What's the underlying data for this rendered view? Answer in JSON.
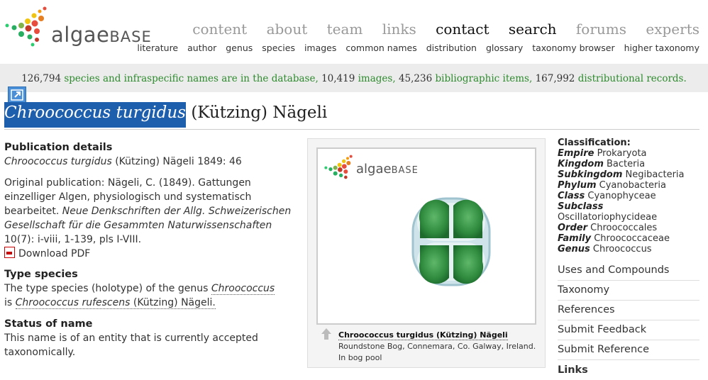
{
  "header": {
    "logo_text": "algae",
    "logo_text_b": "BASE",
    "main_nav": [
      "content",
      "about",
      "team",
      "links",
      "contact",
      "search",
      "forums",
      "experts"
    ],
    "sub_nav": [
      "literature",
      "author",
      "genus",
      "species",
      "images",
      "common names",
      "distribution",
      "glossary",
      "taxonomy browser",
      "higher taxonomy"
    ]
  },
  "stats": {
    "n_species": "126,794",
    "t_species": "species and infraspecific names are in the database,",
    "n_images": "10,419",
    "t_images": "images,",
    "n_biblio": "45,236",
    "t_biblio": "bibliographic items,",
    "n_dist": "167,992",
    "t_dist": "distributional records."
  },
  "title": {
    "name": "Chroococcus turgidus",
    "author": "(Kützing) Nägeli"
  },
  "publication": {
    "heading": "Publication details",
    "name": "Chroococcus turgidus",
    "citation": "(Kützing) Nägeli 1849: 46",
    "orig_prefix": "Original publication: Nägeli, C. (1849). Gattungen einzelliger Algen, physiologisch und systematisch bearbeitet.",
    "orig_journal": "Neue Denkschriften der Allg. Schweizerischen Gesellschaft für die Gesammten Naturwissenschaften",
    "orig_suffix": "10(7): i-viii, 1-139, pls I-VIII.",
    "pdf_label": "Download PDF"
  },
  "type_species": {
    "heading": "Type species",
    "text1": "The type species (holotype) of the genus",
    "genus": "Chroococcus",
    "text2": "is",
    "species": "Chroococcus rufescens",
    "text3": "(Kützing) Nägeli."
  },
  "status": {
    "heading": "Status of name",
    "text": "This name is of an entity that is currently accepted taxonomically."
  },
  "image": {
    "logo_text": "algae",
    "logo_text_b": "BASE",
    "caption_title": "Chroococcus turgidus (Kützing) Nägeli",
    "caption_text": "Roundstone Bog, Connemara, Co. Galway, Ireland. In bog pool"
  },
  "classification": {
    "heading": "Classification:",
    "ranks": [
      {
        "rank": "Empire",
        "value": "Prokaryota"
      },
      {
        "rank": "Kingdom",
        "value": "Bacteria"
      },
      {
        "rank": "Subkingdom",
        "value": "Negibacteria"
      },
      {
        "rank": "Phylum",
        "value": "Cyanobacteria"
      },
      {
        "rank": "Class",
        "value": "Cyanophyceae"
      },
      {
        "rank": "Subclass",
        "value": "Oscillatoriophycideae"
      },
      {
        "rank": "Order",
        "value": "Chroococcales"
      },
      {
        "rank": "Family",
        "value": "Chroococcaceae"
      },
      {
        "rank": "Genus",
        "value": "Chroococcus"
      }
    ]
  },
  "side_links": [
    "Uses and Compounds",
    "Taxonomy",
    "References",
    "Submit Feedback",
    "Submit Reference"
  ],
  "links_heading": "Links",
  "colors": {
    "highlight": "#1e5fad",
    "stats_green": "#2d8a2d",
    "nav_grey": "#999999"
  }
}
